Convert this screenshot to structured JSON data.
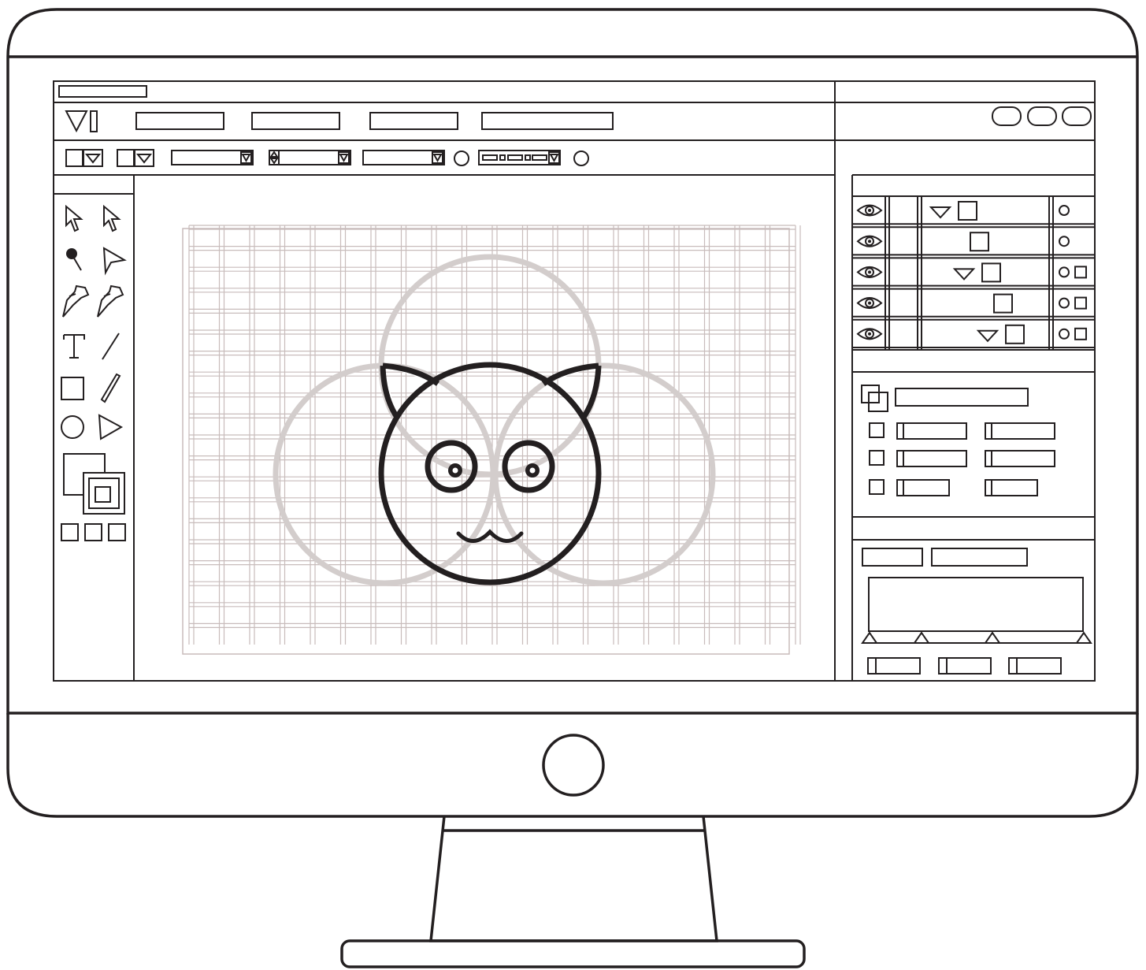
{
  "colors": {
    "outline": "#231f20",
    "background": "#ffffff",
    "grid": "#c8bcbb",
    "guide_circles": "#d3cdcc"
  },
  "app": {
    "logo_icon": "vector-logo-icon",
    "window_buttons": [
      "minimize-button",
      "maximize-button",
      "close-button"
    ]
  },
  "menu": {
    "items": [
      "",
      "",
      "",
      ""
    ]
  },
  "toolbar": {
    "controls": [
      "fill-swatch-dropdown",
      "stroke-swatch-dropdown",
      "font-dropdown",
      "size-stepper-dropdown",
      "style-dropdown",
      "option-radio",
      "align-segmented-dropdown",
      "option-radio-2"
    ]
  },
  "tools": [
    {
      "name": "selection-tool",
      "icon": "arrow-pointer-icon"
    },
    {
      "name": "direct-selection-tool",
      "icon": "hollow-arrow-icon"
    },
    {
      "name": "magic-wand-tool",
      "icon": "magic-wand-icon"
    },
    {
      "name": "lasso-tool",
      "icon": "triangle-pointer-icon"
    },
    {
      "name": "pen-tool",
      "icon": "pen-nib-icon"
    },
    {
      "name": "pen-add-tool",
      "icon": "pen-nib-alt-icon"
    },
    {
      "name": "type-tool",
      "icon": "text-t-icon"
    },
    {
      "name": "line-tool",
      "icon": "line-segment-icon"
    },
    {
      "name": "rectangle-tool",
      "icon": "square-icon"
    },
    {
      "name": "pencil-tool",
      "icon": "pencil-line-icon"
    },
    {
      "name": "ellipse-tool",
      "icon": "circle-icon"
    },
    {
      "name": "polygon-tool",
      "icon": "triangle-icon"
    }
  ],
  "layers": {
    "rows": [
      {
        "expandable": true,
        "extras": 1
      },
      {
        "expandable": false,
        "extras": 1
      },
      {
        "expandable": true,
        "extras": 2
      },
      {
        "expandable": false,
        "extras": 2
      },
      {
        "expandable": true,
        "extras": 2
      }
    ]
  },
  "properties": {
    "checkbox_rows": 3
  },
  "gradient": {
    "stops": 4,
    "buttons": 3
  },
  "canvas": {
    "subject": "cat-face-logo",
    "guide_circles": 3,
    "grid": true
  }
}
